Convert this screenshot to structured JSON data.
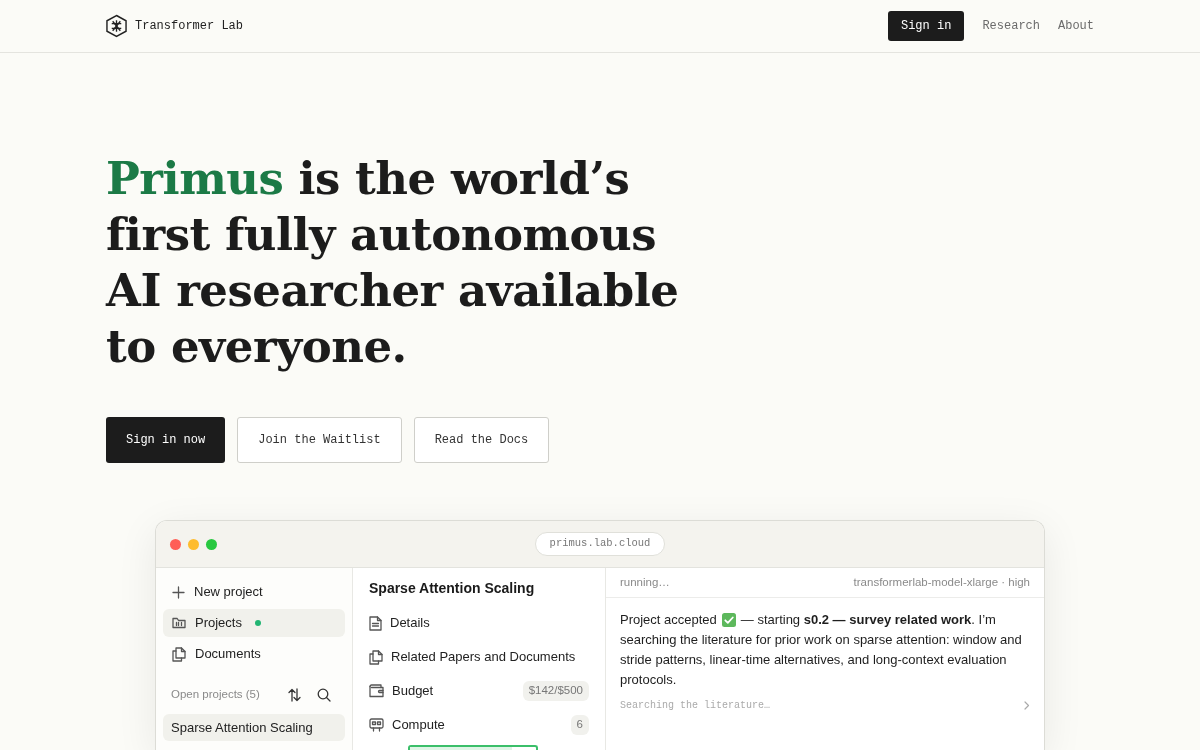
{
  "nav": {
    "brand": "Transformer Lab",
    "links": [
      {
        "label": "Sign in",
        "kind": "button"
      },
      {
        "label": "Research",
        "kind": "link"
      },
      {
        "label": "About",
        "kind": "link"
      }
    ]
  },
  "hero": {
    "highlight": "Primus",
    "headline": "is the world’s first fully autonomous AI researcher available to everyone.",
    "buttons": [
      {
        "label": "Sign in now",
        "kind": "primary"
      },
      {
        "label": "Join the Waitlist",
        "kind": "secondary"
      },
      {
        "label": "Read the Docs",
        "kind": "secondary"
      }
    ]
  },
  "app_window": {
    "url": "primus.lab.cloud",
    "sidebar": {
      "items": [
        {
          "label": "New project",
          "selected": false,
          "notification": false
        },
        {
          "label": "Projects",
          "selected": true,
          "notification": true
        },
        {
          "label": "Documents",
          "selected": false,
          "notification": false
        }
      ],
      "open_projects": {
        "title": "Open projects (5)",
        "items": [
          {
            "label": "Sparse Attention Scaling",
            "selected": true
          }
        ]
      }
    },
    "project": {
      "title": "Sparse Attention Scaling",
      "items": [
        {
          "label": "Details"
        },
        {
          "label": "Related Papers and Documents"
        },
        {
          "label": "Budget",
          "badge": "$142/$500"
        },
        {
          "label": "Compute",
          "badge": "6"
        }
      ],
      "compute_usage": {
        "level": 0.81
      }
    },
    "agent": {
      "status": "running…",
      "model": "transformerlab-model-xlarge · high",
      "message": {
        "before_icon": "Project accepted",
        "after_icon": "— starting **s0.2 — survey related work**. I’m",
        "continuation": "searching the literature for prior work on sparse attention: window and stride patterns, linear-time alternatives, and long-context evaluation protocols."
      },
      "activity": "Searching the literature…"
    }
  }
}
